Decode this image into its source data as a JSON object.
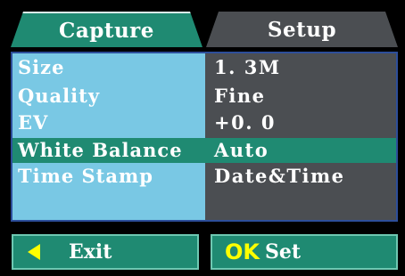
{
  "tabs": [
    {
      "label": "Capture",
      "active": true
    },
    {
      "label": "Setup",
      "active": false
    }
  ],
  "menu": {
    "selected": "White Balance",
    "rows": [
      {
        "label": "Size",
        "value": "1. 3M"
      },
      {
        "label": "Quality",
        "value": "Fine"
      },
      {
        "label": "EV",
        "value": "+0. 0"
      },
      {
        "label": "White Balance",
        "value": "Auto"
      },
      {
        "label": "Time Stamp",
        "value": "Date&Time"
      }
    ]
  },
  "buttons": {
    "exit_label": "Exit",
    "ok_label": "OK",
    "set_label": "Set"
  },
  "icons": {
    "exit": "left-arrow-icon"
  },
  "colors": {
    "accent_green": "#1f8a72",
    "label_blue": "#79c8e4",
    "panel_gray": "#4b4e52",
    "highlight_yellow": "#ffff00",
    "border_blue": "#2d4e9a"
  }
}
